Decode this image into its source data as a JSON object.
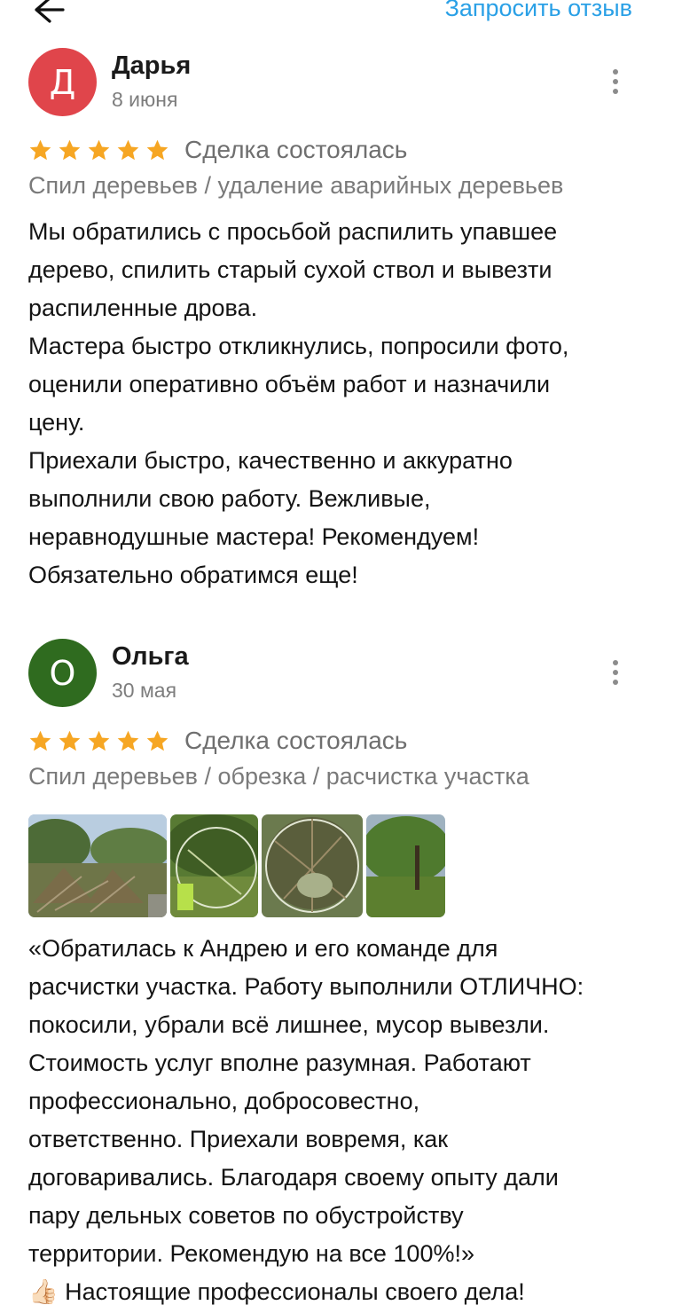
{
  "header": {
    "request_review_label": "Запросить отзыв"
  },
  "reviews": [
    {
      "avatar_letter": "Д",
      "avatar_color": "#e0454b",
      "name": "Дарья",
      "date": "8 июня",
      "rating": 5,
      "deal_status": "Сделка состоялась",
      "category": "Спил деревьев / удаление аварийных деревьев",
      "text_lines": [
        "Мы обратились с просьбой распилить упавшее",
        "дерево, спилить старый сухой ствол и вывезти",
        "распиленные дрова.",
        "Мастера быстро откликнулись, попросили фото,",
        "оценили оперативно объём работ и назначили",
        "цену.",
        "Приехали быстро,  качественно и аккуратно",
        "выполнили свою работу. Вежливые,",
        "неравнодушные мастера! Рекомендуем!",
        "Обязательно обратимся еще!"
      ]
    },
    {
      "avatar_letter": "О",
      "avatar_color": "#2f6b1f",
      "name": "Ольга",
      "date": "30 мая",
      "rating": 5,
      "deal_status": "Сделка состоялась",
      "category": "Спил деревьев / обрезка / расчистка участка",
      "text_lines": [
        "«Обратилась к Андрею и его команде для",
        "расчистки участка. Работу выполнили ОТЛИЧНО:",
        "покосили, убрали всё лишнее, мусор  вывезли.",
        "Стоимость услуг вполне разумная. Работают",
        "профессионально, добросовестно,",
        "ответственно. Приехали вовремя, как",
        "договаривались. Благодаря своему опыту дали",
        "пару дельных советов по обустройству",
        "территории. Рекомендую на все 100%!»",
        "👍🏻 Настоящие профессионалы своего дела!"
      ]
    }
  ],
  "colors": {
    "accent": "#2aa0e6",
    "star": "#f6a623",
    "muted_text": "#7a7a7a"
  },
  "icons": [
    "arrow-left-icon",
    "more-vertical-icon",
    "star-icon"
  ]
}
